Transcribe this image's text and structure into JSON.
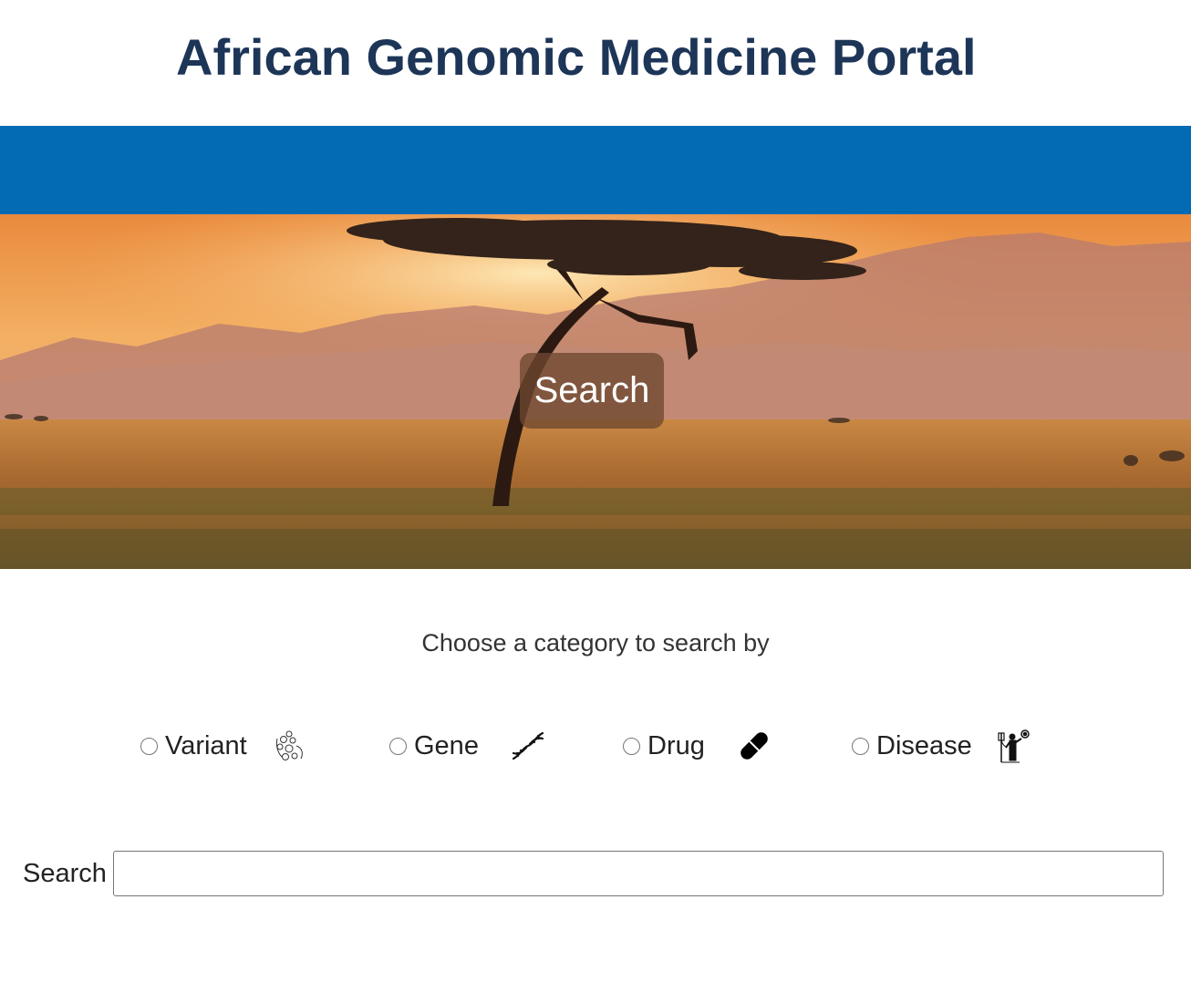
{
  "header": {
    "title": "African Genomic Medicine Portal"
  },
  "hero": {
    "search_button_label": "Search",
    "image": "acacia tree savanna at sunset"
  },
  "category_section": {
    "prompt": "Choose a category to search by",
    "options": [
      {
        "label": "Variant",
        "icon": "variant-icon",
        "selected": false
      },
      {
        "label": "Gene",
        "icon": "dna-icon",
        "selected": false
      },
      {
        "label": "Drug",
        "icon": "pill-icon",
        "selected": false
      },
      {
        "label": "Disease",
        "icon": "patient-iv-icon",
        "selected": false
      }
    ]
  },
  "search": {
    "label": "Search",
    "value": "",
    "placeholder": ""
  },
  "colors": {
    "title": "#1d3557",
    "nav_bar": "#036bb4",
    "hero_button": "#6e4830"
  }
}
